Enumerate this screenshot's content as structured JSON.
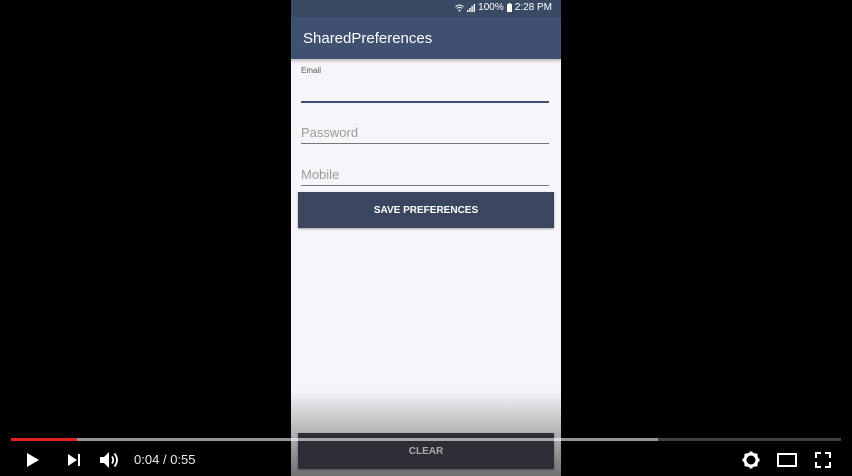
{
  "status_bar": {
    "battery": "100%",
    "time": "2:28 PM"
  },
  "app": {
    "title": "SharedPreferences"
  },
  "form": {
    "email_label": "Email",
    "password_placeholder": "Password",
    "mobile_placeholder": "Mobile",
    "save_button": "SAVE PREFERENCES",
    "clear_button": "CLEAR"
  },
  "player": {
    "current_time": "0:04",
    "separator": "/",
    "duration": "0:55",
    "played_fraction": 0.08,
    "buffered_fraction": 0.78,
    "icons": [
      "play-icon",
      "next-icon",
      "volume-icon",
      "settings-icon",
      "theater-mode-icon",
      "fullscreen-icon"
    ]
  }
}
